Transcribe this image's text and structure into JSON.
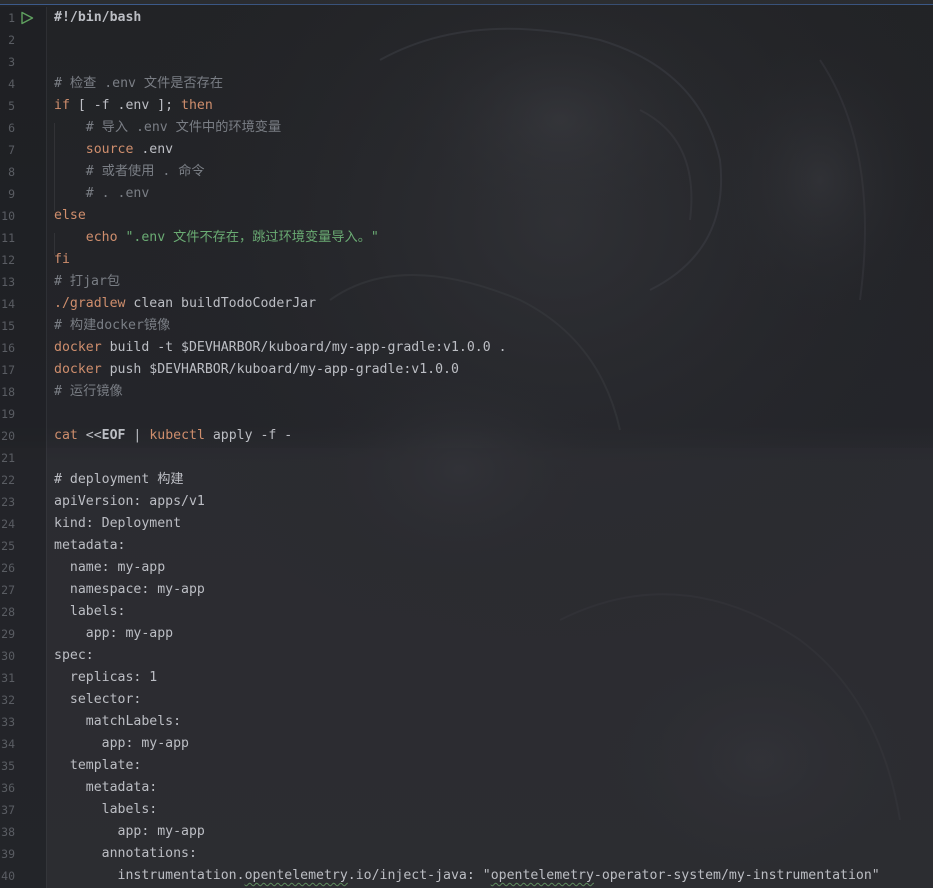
{
  "editor": {
    "accent_run": "#5fa05f",
    "lines": [
      {
        "n": "1",
        "parts": [
          {
            "t": "#!/bin/bash",
            "c": "bold"
          }
        ],
        "run": true
      },
      {
        "n": "2",
        "parts": []
      },
      {
        "n": "3",
        "parts": []
      },
      {
        "n": "4",
        "parts": [
          {
            "t": "# 检查 .env 文件是否存在",
            "c": "comment"
          }
        ]
      },
      {
        "n": "5",
        "parts": [
          {
            "t": "if",
            "c": "kw"
          },
          {
            "t": " [ -f .env ]; ",
            "c": "var"
          },
          {
            "t": "then",
            "c": "kw"
          }
        ]
      },
      {
        "n": "6",
        "parts": [
          {
            "t": "    # 导入 .env 文件中的环境变量",
            "c": "comment"
          }
        ]
      },
      {
        "n": "7",
        "parts": [
          {
            "t": "    ",
            "c": "var"
          },
          {
            "t": "source",
            "c": "kw"
          },
          {
            "t": " .env",
            "c": "var"
          }
        ]
      },
      {
        "n": "8",
        "parts": [
          {
            "t": "    # 或者使用 . 命令",
            "c": "comment"
          }
        ]
      },
      {
        "n": "9",
        "parts": [
          {
            "t": "    # . .env",
            "c": "comment"
          }
        ]
      },
      {
        "n": "10",
        "parts": [
          {
            "t": "else",
            "c": "kw"
          }
        ]
      },
      {
        "n": "11",
        "parts": [
          {
            "t": "    ",
            "c": "var"
          },
          {
            "t": "echo",
            "c": "kw"
          },
          {
            "t": " \".env 文件不存在，跳过环境变量导入。\"",
            "c": "str"
          }
        ]
      },
      {
        "n": "12",
        "parts": [
          {
            "t": "fi",
            "c": "kw"
          }
        ]
      },
      {
        "n": "13",
        "parts": [
          {
            "t": "# 打jar包",
            "c": "comment"
          }
        ]
      },
      {
        "n": "14",
        "parts": [
          {
            "t": "./gradlew",
            "c": "kw"
          },
          {
            "t": " clean buildTodoCoderJar",
            "c": "var"
          }
        ]
      },
      {
        "n": "15",
        "parts": [
          {
            "t": "# 构建docker镜像",
            "c": "comment"
          }
        ]
      },
      {
        "n": "16",
        "parts": [
          {
            "t": "docker",
            "c": "kw"
          },
          {
            "t": " build -t $DEVHARBOR/kuboard/my-app-gradle:v1.0.0 .",
            "c": "var"
          }
        ]
      },
      {
        "n": "17",
        "parts": [
          {
            "t": "docker",
            "c": "kw"
          },
          {
            "t": " push $DEVHARBOR/kuboard/my-app-gradle:v1.0.0",
            "c": "var"
          }
        ]
      },
      {
        "n": "18",
        "parts": [
          {
            "t": "# 运行镜像",
            "c": "comment"
          }
        ]
      },
      {
        "n": "19",
        "parts": []
      },
      {
        "n": "20",
        "parts": [
          {
            "t": "cat",
            "c": "kw"
          },
          {
            "t": " <<",
            "c": "var"
          },
          {
            "t": "EOF",
            "c": "bold"
          },
          {
            "t": " | ",
            "c": "var"
          },
          {
            "t": "kubectl",
            "c": "kw"
          },
          {
            "t": " apply -f -",
            "c": "var"
          }
        ]
      },
      {
        "n": "21",
        "parts": []
      },
      {
        "n": "22",
        "parts": [
          {
            "t": "# deployment 构建",
            "c": "var"
          }
        ]
      },
      {
        "n": "23",
        "parts": [
          {
            "t": "apiVersion: apps/v1",
            "c": "var"
          }
        ]
      },
      {
        "n": "24",
        "parts": [
          {
            "t": "kind: Deployment",
            "c": "var"
          }
        ]
      },
      {
        "n": "25",
        "parts": [
          {
            "t": "metadata:",
            "c": "var"
          }
        ]
      },
      {
        "n": "26",
        "parts": [
          {
            "t": "  name: my-app",
            "c": "var"
          }
        ]
      },
      {
        "n": "27",
        "parts": [
          {
            "t": "  namespace: my-app",
            "c": "var"
          }
        ]
      },
      {
        "n": "28",
        "parts": [
          {
            "t": "  labels:",
            "c": "var"
          }
        ]
      },
      {
        "n": "29",
        "parts": [
          {
            "t": "    app: my-app",
            "c": "var"
          }
        ]
      },
      {
        "n": "30",
        "parts": [
          {
            "t": "spec:",
            "c": "var"
          }
        ]
      },
      {
        "n": "31",
        "parts": [
          {
            "t": "  replicas: 1",
            "c": "var"
          }
        ]
      },
      {
        "n": "32",
        "parts": [
          {
            "t": "  selector:",
            "c": "var"
          }
        ]
      },
      {
        "n": "33",
        "parts": [
          {
            "t": "    matchLabels:",
            "c": "var"
          }
        ]
      },
      {
        "n": "34",
        "parts": [
          {
            "t": "      app: my-app",
            "c": "var"
          }
        ]
      },
      {
        "n": "35",
        "parts": [
          {
            "t": "  template:",
            "c": "var"
          }
        ]
      },
      {
        "n": "36",
        "parts": [
          {
            "t": "    metadata:",
            "c": "var"
          }
        ]
      },
      {
        "n": "37",
        "parts": [
          {
            "t": "      labels:",
            "c": "var"
          }
        ]
      },
      {
        "n": "38",
        "parts": [
          {
            "t": "        app: my-app",
            "c": "var"
          }
        ]
      },
      {
        "n": "39",
        "parts": [
          {
            "t": "      annotations:",
            "c": "var"
          }
        ]
      },
      {
        "n": "40",
        "parts": [
          {
            "t": "        instrumentation.",
            "c": "var"
          },
          {
            "t": "opentelemetry",
            "c": "var wavy"
          },
          {
            "t": ".io/inject-java: \"",
            "c": "var"
          },
          {
            "t": "opentelemetry",
            "c": "var wavy"
          },
          {
            "t": "-operator-system/my-instrumentation\"",
            "c": "var"
          }
        ]
      }
    ]
  }
}
